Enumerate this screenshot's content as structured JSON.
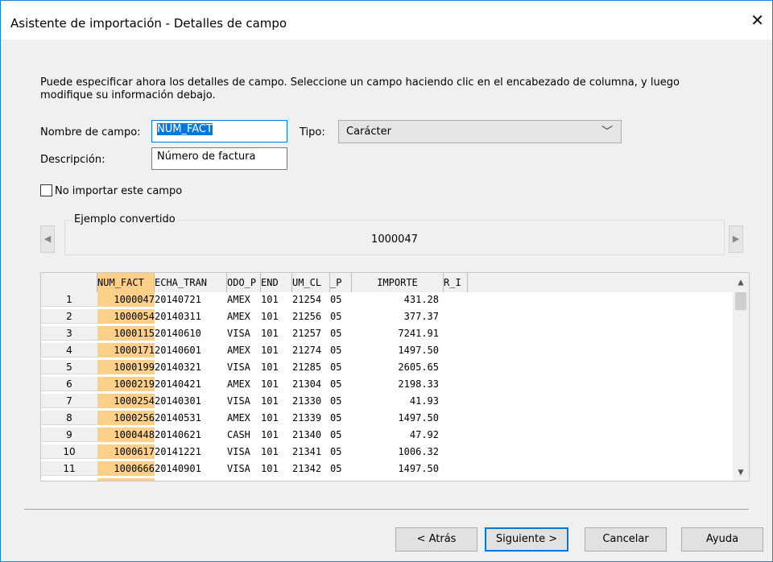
{
  "window": {
    "title": "Asistente de importación - Detalles de campo",
    "close_glyph": "✕"
  },
  "description": "Puede especificar ahora los detalles de campo. Seleccione un campo haciendo clic en el encabezado de columna, y luego modifique su información debajo.",
  "form": {
    "field_name_label": "Nombre de campo:",
    "field_name_value": "NUM_FACT",
    "type_label": "Tipo:",
    "type_value": "Carácter",
    "description_label": "Descripción:",
    "description_value": "Número de factura",
    "skip_label": "No importar este campo",
    "skip_checked": false
  },
  "example": {
    "title": "Ejemplo convertido",
    "value": "1000047"
  },
  "grid": {
    "columns": [
      "NUM_FACT",
      "ECHA_TRAN",
      "ODO_P",
      "END",
      "UM_CL",
      "_P",
      "IMPORTE",
      "R_I"
    ],
    "selected_column": 0,
    "rows": [
      {
        "n": "1",
        "c": [
          "1000047",
          "20140721",
          "AMEX",
          "101",
          "21254",
          "05",
          "431.28"
        ]
      },
      {
        "n": "2",
        "c": [
          "1000054",
          "20140311",
          "AMEX",
          "101",
          "21256",
          "05",
          "377.37"
        ]
      },
      {
        "n": "3",
        "c": [
          "1000115",
          "20140610",
          "VISA",
          "101",
          "21257",
          "05",
          "7241.91"
        ]
      },
      {
        "n": "4",
        "c": [
          "1000171",
          "20140601",
          "AMEX",
          "101",
          "21274",
          "05",
          "1497.50"
        ]
      },
      {
        "n": "5",
        "c": [
          "1000199",
          "20140321",
          "VISA",
          "101",
          "21285",
          "05",
          "2605.65"
        ]
      },
      {
        "n": "6",
        "c": [
          "1000219",
          "20140421",
          "AMEX",
          "101",
          "21304",
          "05",
          "2198.33"
        ]
      },
      {
        "n": "7",
        "c": [
          "1000254",
          "20140301",
          "VISA",
          "101",
          "21330",
          "05",
          "41.93"
        ]
      },
      {
        "n": "8",
        "c": [
          "1000256",
          "20140531",
          "AMEX",
          "101",
          "21339",
          "05",
          "1497.50"
        ]
      },
      {
        "n": "9",
        "c": [
          "1000448",
          "20140621",
          "CASH",
          "101",
          "21340",
          "05",
          "47.92"
        ]
      },
      {
        "n": "10",
        "c": [
          "1000617",
          "20141221",
          "VISA",
          "101",
          "21341",
          "05",
          "1006.32"
        ]
      },
      {
        "n": "11",
        "c": [
          "1000666",
          "20140901",
          "VISA",
          "101",
          "21342",
          "05",
          "1497.50"
        ]
      }
    ]
  },
  "buttons": {
    "back": "< Atrás",
    "next": "Siguiente >",
    "cancel": "Cancelar",
    "help": "Ayuda"
  },
  "colors": {
    "selected_column": "#fcd089",
    "accent": "#0078d7"
  }
}
